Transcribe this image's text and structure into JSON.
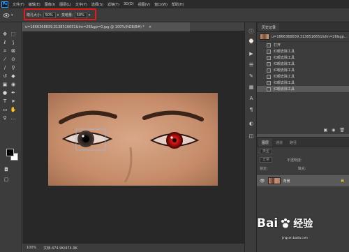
{
  "menubar": {
    "logo": "Ps",
    "items": [
      "文件(F)",
      "编辑(E)",
      "图像(I)",
      "图层(L)",
      "文字(Y)",
      "选择(S)",
      "滤镜(T)",
      "3D(D)",
      "视图(V)",
      "窗口(W)",
      "帮助(H)"
    ]
  },
  "options": {
    "pupil_size_label": "瞳孔大小:",
    "pupil_size_value": "50%",
    "darken_label": "变暗量:",
    "darken_value": "50%",
    "highlight_color": "#e21b1b"
  },
  "document": {
    "tab_title": "u=1866368839,3138516651&fm=26&gp=0.jpg @ 100%(RGB/8#) *",
    "close": "×"
  },
  "statusbar": {
    "zoom": "100%",
    "doc_info": "文档:474.9K/474.9K"
  },
  "history": {
    "tab": "历史记录",
    "snapshot": "u=1866368839,3138516651&fm=26&gp...",
    "items": [
      "打开",
      "红眼去除工具",
      "红眼去除工具",
      "红眼去除工具",
      "红眼去除工具",
      "红眼去除工具",
      "红眼去除工具",
      "红眼去除工具"
    ]
  },
  "layers": {
    "tabs": [
      "图层",
      "通道",
      "路径"
    ],
    "kind_label": "类型",
    "blend_mode": "正常",
    "opacity_label": "不透明度:",
    "lock_label": "锁定:",
    "fill_label": "填充:",
    "layer_name": "背景"
  },
  "watermark": {
    "brand": "Bai",
    "brand2": "经验",
    "sub": "jingyan.baidu.com"
  },
  "colors": {
    "menubar": "#2b2b2b",
    "panel": "#3c3c3c",
    "canvas_bg": "#282828",
    "accent": "#31a8ff"
  }
}
